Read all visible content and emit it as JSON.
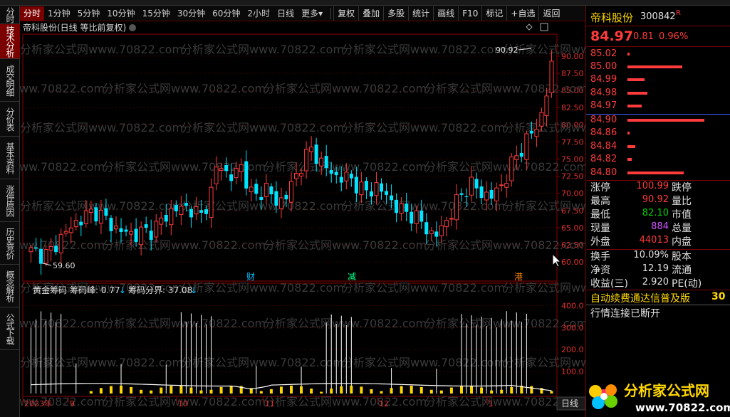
{
  "toolbar": {
    "periods": [
      "分时",
      "1分钟",
      "5分钟",
      "10分钟",
      "15分钟",
      "30分钟",
      "60分钟",
      "2小时",
      "日线",
      "更多"
    ],
    "more_arrow": "▾",
    "active_period": "分时",
    "buttons": [
      "复权",
      "叠加",
      "多股",
      "统计",
      "画线",
      "F10",
      "标记",
      "+自选",
      "返回"
    ]
  },
  "left_nav": [
    "分时走势",
    "技术分析",
    "成交明细",
    "分价表",
    "基本资料",
    "涨停原因",
    "历史竞价",
    "概念解析",
    "公式下载"
  ],
  "left_nav_active": "技术分析",
  "chart": {
    "header": "帝科股份(日线 等比前复权)",
    "high_label": "90.92",
    "low_label": "59.60",
    "y_ticks": [
      "90.00",
      "87.50",
      "85.00",
      "82.50",
      "80.00",
      "77.50",
      "75.00",
      "72.50",
      "70.00",
      "67.50",
      "65.00",
      "62.50",
      "60.00"
    ],
    "event_markers": [
      {
        "label": "财",
        "color": "#00bfff"
      },
      {
        "label": "减",
        "color": "#00ff88"
      },
      {
        "label": "港",
        "color": "#ff8800"
      }
    ],
    "indicator_name": "黄金筹码",
    "indicator_peak_label": "筹码峰:",
    "indicator_peak_value": "0.77",
    "indicator_split_label": "筹码分界:",
    "indicator_split_value": "37.08",
    "arrow": "↓",
    "ind_y_ticks": [
      "400.0",
      "300.0",
      "200.0",
      "100.0"
    ],
    "x_labels": [
      "2023年",
      "9",
      "10",
      "11",
      "12",
      "1"
    ],
    "period_tab": "日线",
    "watermark": "分析家公式网www.70822.com"
  },
  "right_panel": {
    "stock_name": "帝科股份",
    "stock_code": "300842",
    "stock_code_tag": "R",
    "price": "84.97",
    "change": "0.81",
    "change_pct": "0.96%",
    "asks": [
      {
        "price": "85.02",
        "vol_frac": 0.03
      },
      {
        "price": "85.00",
        "vol_frac": 0.7
      },
      {
        "price": "84.99",
        "vol_frac": 0.22
      },
      {
        "price": "84.98",
        "vol_frac": 0.25
      },
      {
        "price": "84.97",
        "vol_frac": 0.18
      }
    ],
    "bids": [
      {
        "price": "84.90",
        "vol_frac": 0.98
      },
      {
        "price": "84.86",
        "vol_frac": 0.03
      },
      {
        "price": "84.84",
        "vol_frac": 0.1
      },
      {
        "price": "84.82",
        "vol_frac": 0.05
      },
      {
        "price": "84.80",
        "vol_frac": 0.72
      }
    ],
    "stats": [
      {
        "left_label": "涨停",
        "left_value": "100.99",
        "left_color": "red",
        "right_label": "跌停"
      },
      {
        "left_label": "最高",
        "left_value": "90.92",
        "left_color": "red",
        "right_label": "量比"
      },
      {
        "left_label": "最低",
        "left_value": "82.10",
        "left_color": "green",
        "right_label": "市值"
      },
      {
        "left_label": "现量",
        "left_value": "884",
        "left_color": "magenta",
        "right_label": "总量"
      },
      {
        "left_label": "外盘",
        "left_value": "44013",
        "left_color": "red",
        "right_label": "内盘"
      }
    ],
    "stats2": [
      {
        "left_label": "换手",
        "left_value": "10.09%",
        "right_label": "股本"
      },
      {
        "left_label": "净资",
        "left_value": "12.19",
        "right_label": "流通"
      },
      {
        "left_label": "收益(三)",
        "left_value": "2.920",
        "right_label": "PE(动)"
      }
    ],
    "ad_text": "自动续费通达信普及版",
    "ad_suffix": "30",
    "status": "行情连接已断开"
  },
  "logo": {
    "text": "分析家公式网",
    "url": "www.70822.com"
  },
  "colors": {
    "up": "#ff3b3b",
    "down": "#00e5ff",
    "accent": "#7a0000",
    "indicator_bar": "#ffd700"
  }
}
